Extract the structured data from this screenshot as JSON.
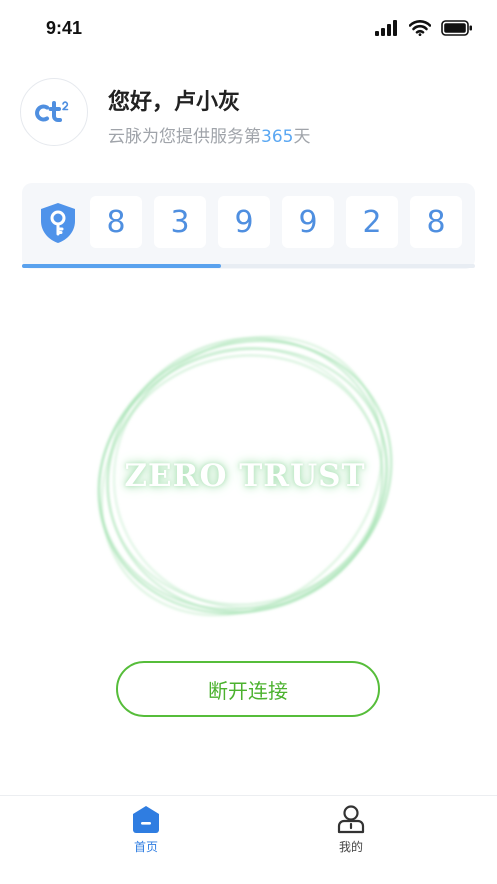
{
  "status_bar": {
    "time": "9:41",
    "icons": [
      "signal-icon",
      "wifi-icon",
      "battery-icon"
    ]
  },
  "header": {
    "avatar_logo": "ct²",
    "greeting": "您好，卢小灰",
    "service_prefix": "云脉为您提供服务第",
    "service_days": "365",
    "service_suffix": "天"
  },
  "code_card": {
    "icon": "shield-key-icon",
    "digits": [
      "8",
      "3",
      "9",
      "9",
      "2",
      "8"
    ],
    "progress": 0.44
  },
  "center": {
    "title": "ZERO TRUST"
  },
  "actions": {
    "disconnect_label": "断开连接"
  },
  "tabbar": {
    "items": [
      {
        "label": "首页",
        "icon": "home-icon",
        "active": true
      },
      {
        "label": "我的",
        "icon": "user-icon",
        "active": false
      }
    ]
  },
  "colors": {
    "accent_blue": "#2f7de1",
    "digit_blue": "#4f8fe0",
    "green": "#56bd3a",
    "ring_green": "#9fe0ad"
  }
}
